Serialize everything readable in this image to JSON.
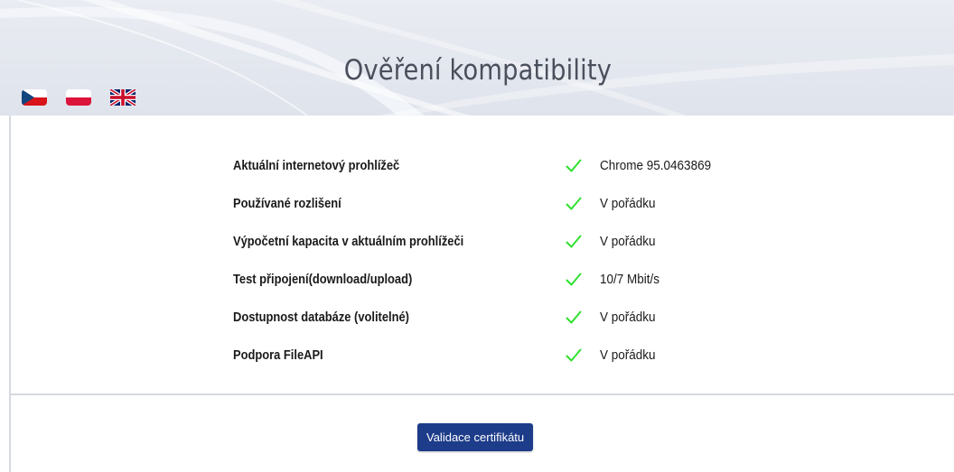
{
  "header": {
    "title": "Ověření kompatibility"
  },
  "languages": [
    {
      "code": "cs",
      "icon": "czech-flag-icon"
    },
    {
      "code": "pl",
      "icon": "polish-flag-icon"
    },
    {
      "code": "en",
      "icon": "uk-flag-icon"
    }
  ],
  "checks": [
    {
      "label": "Aktuální internetový prohlížeč",
      "status": "ok",
      "value": "Chrome 95.0463869"
    },
    {
      "label": "Používané rozlišení",
      "status": "ok",
      "value": "V pořádku"
    },
    {
      "label": "Výpočetní kapacita v aktuálním prohlížeči",
      "status": "ok",
      "value": "V pořádku"
    },
    {
      "label": "Test připojení(download/upload)",
      "status": "ok",
      "value": "10/7 Mbit/s"
    },
    {
      "label": "Dostupnost databáze (volitelné)",
      "status": "ok",
      "value": "V pořádku"
    },
    {
      "label": "Podpora FileAPI",
      "status": "ok",
      "value": "V pořádku"
    }
  ],
  "actions": {
    "validate_label": "Validace certifikátu"
  },
  "colors": {
    "check": "#2fe02f",
    "button": "#1d3c8a",
    "header_bg": "#e4e8ef",
    "title": "#4a4f5c"
  }
}
